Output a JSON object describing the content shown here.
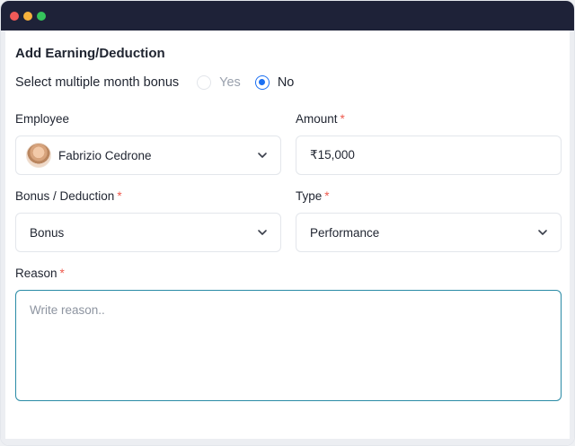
{
  "window": {
    "controls": {
      "close_color": "#f05a58",
      "minimize_color": "#f6b13c",
      "maximize_color": "#35c45b"
    }
  },
  "form": {
    "title": "Add Earning/Deduction",
    "multiple_month_bonus": {
      "label": "Select multiple month bonus",
      "options": [
        "Yes",
        "No"
      ],
      "selected": "No"
    },
    "employee": {
      "label": "Employee",
      "value": "Fabrizio Cedrone",
      "icon": "chevron-down-icon"
    },
    "amount": {
      "label": "Amount",
      "required_mark": "*",
      "value": "₹15,000"
    },
    "bonus_deduction": {
      "label": "Bonus / Deduction",
      "required_mark": "*",
      "value": "Bonus",
      "icon": "chevron-down-icon"
    },
    "type": {
      "label": "Type",
      "required_mark": "*",
      "value": "Performance",
      "icon": "chevron-down-icon"
    },
    "reason": {
      "label": "Reason",
      "required_mark": "*",
      "placeholder": "Write reason.."
    }
  },
  "colors": {
    "accent": "#1a6ff2",
    "required": "#ee5a4e",
    "focus_border": "#2a8ba6",
    "titlebar": "#1e2238"
  }
}
